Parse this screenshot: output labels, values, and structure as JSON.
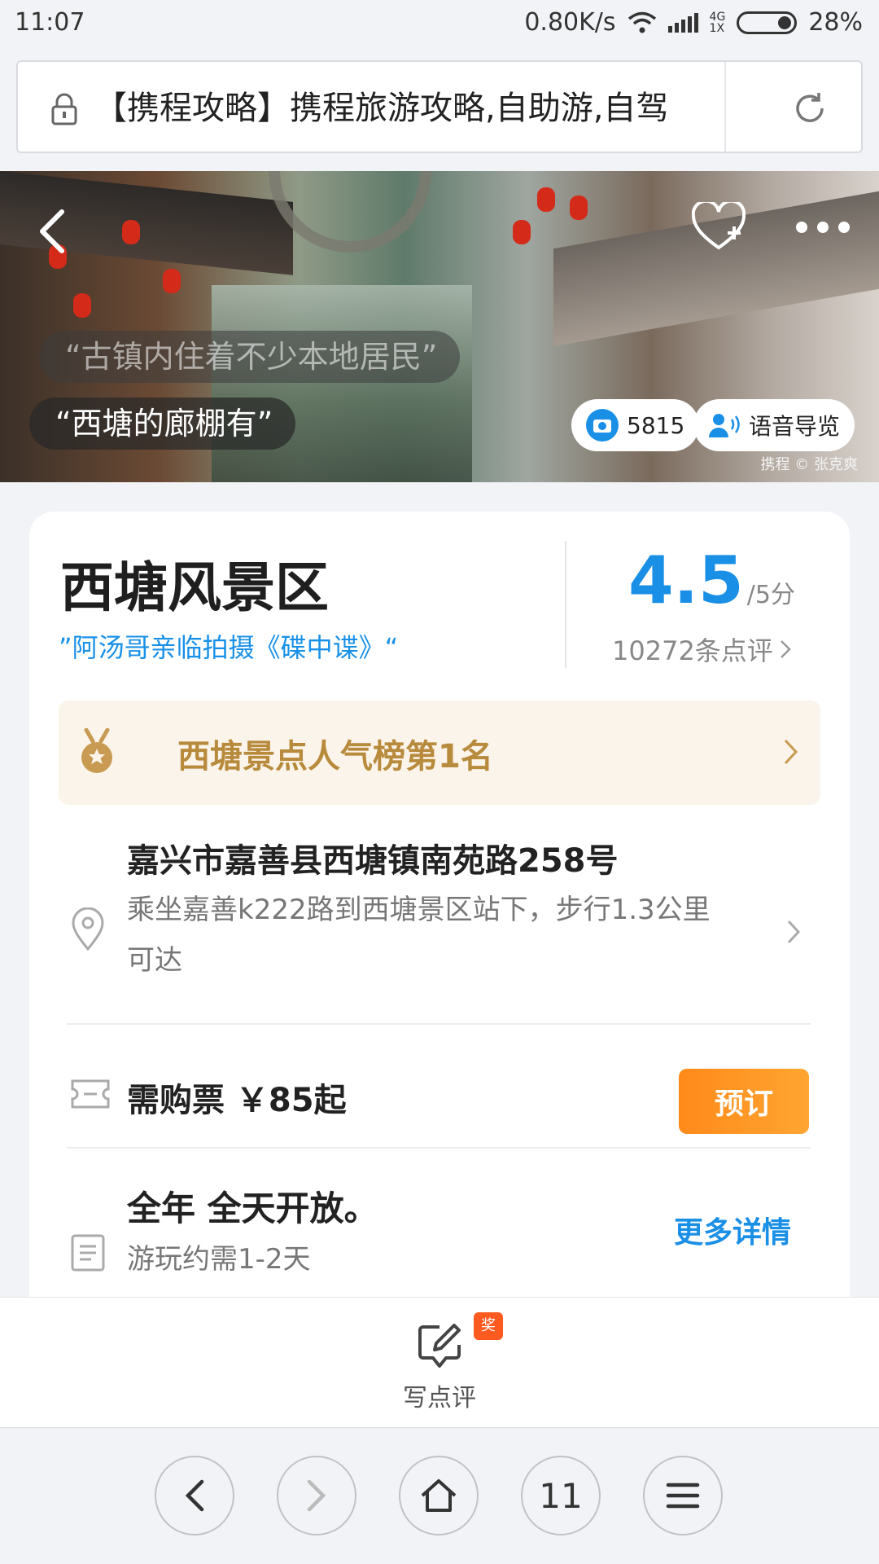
{
  "status_bar": {
    "time": "11:07",
    "speed": "0.80K/s",
    "network_top": "4G",
    "network_bottom": "1X",
    "battery": "28%"
  },
  "url_bar": {
    "text": "【携程攻略】携程旅游攻略,自助游,自驾"
  },
  "hero": {
    "bubble_faded": "“古镇内住着不少本地居民”",
    "bubble": "“西塘的廊棚有”",
    "photo_count": "5815",
    "audio_guide": "语音导览",
    "credit": "携程 © 张克爽"
  },
  "card": {
    "title": "西塘风景区",
    "subtitle": "”阿汤哥亲临拍摄《碟中谍》“",
    "score": "4.5",
    "score_unit": "/5分",
    "reviews": "10272条点评",
    "rank_text": "西塘景点人气榜第1名",
    "address": "嘉兴市嘉善县西塘镇南苑路258号",
    "directions": "乘坐嘉善k222路到西塘景区站下，步行1.3公里可达",
    "ticket": "需购票 ￥85起",
    "book_label": "预订",
    "hours": "全年 全天开放。",
    "duration": "游玩约需1-2天",
    "more_label": "更多详情"
  },
  "review_bar": {
    "badge": "奖",
    "label": "写点评"
  },
  "browser_nav": {
    "tabs_count": "11"
  },
  "colors": {
    "accent": "#1a8fe6",
    "book": "#ff8a1a",
    "rank": "#b88a3c"
  }
}
